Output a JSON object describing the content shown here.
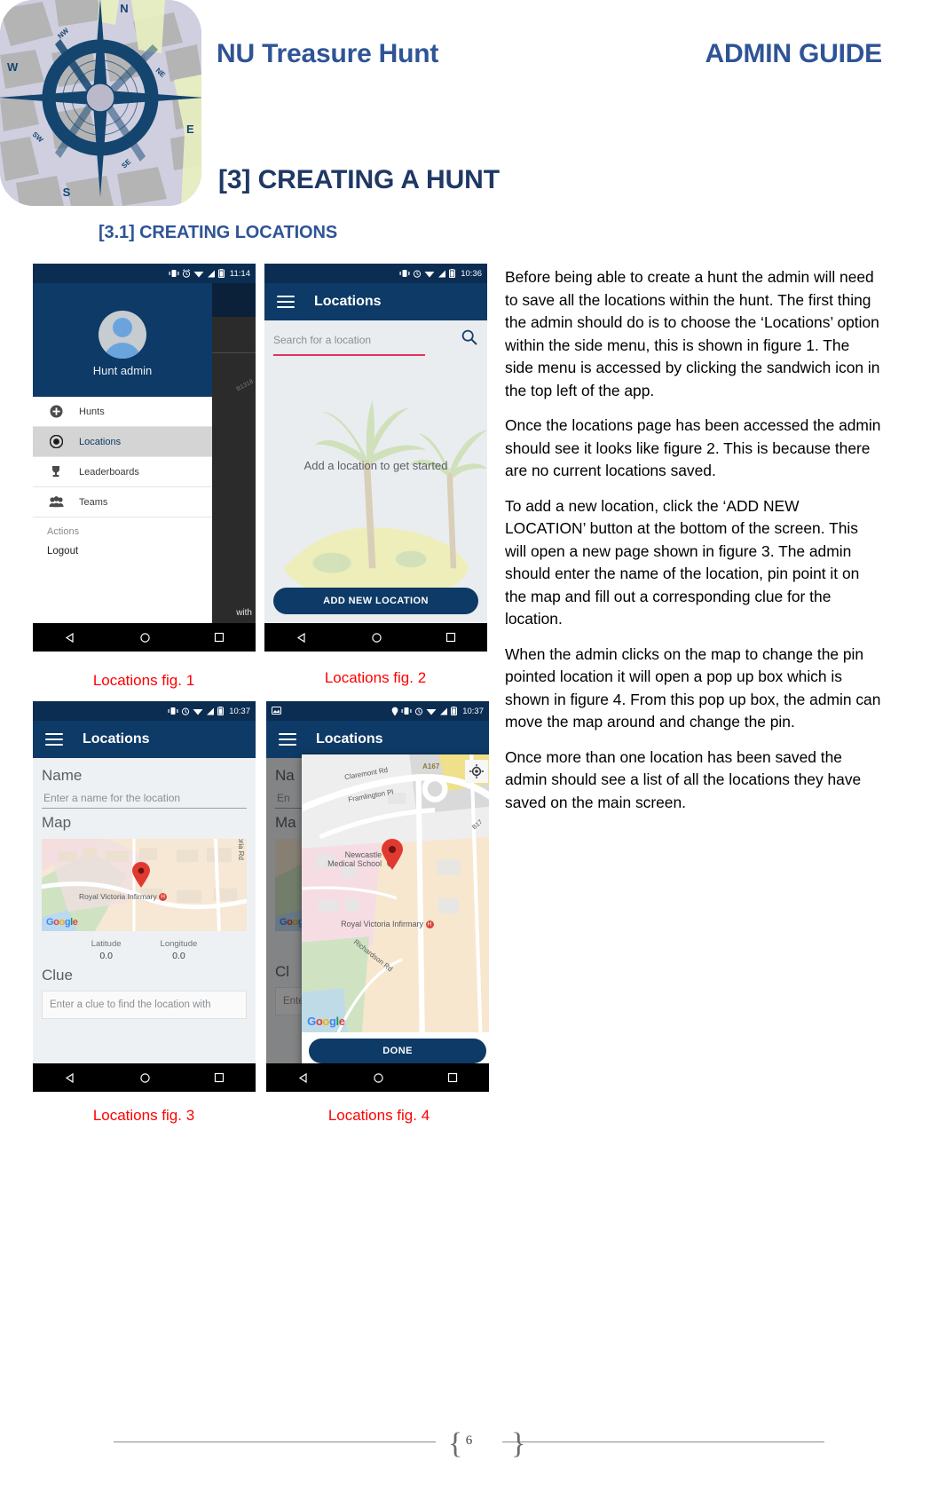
{
  "header": {
    "logo_alt": "compass-rose-map-logo",
    "title": "NU Treasure Hunt",
    "subtitle": "ADMIN GUIDE",
    "brand_color": "#2f5496"
  },
  "headings": {
    "h1": "[3] CREATING A HUNT",
    "h2": "[3.1] CREATING LOCATIONS"
  },
  "body": {
    "paragraphs": [
      "Before being able to create a hunt the admin will need to save all the locations within the hunt. The first thing the admin should do is to choose the ‘Locations’ option within the side menu, this is shown in figure 1. The side menu is accessed by clicking the sandwich icon in the top left of the app.",
      "Once the locations page has been accessed the admin should see it looks like figure 2. This is because there are no current locations saved.",
      "To add a new location, click the ‘ADD NEW LOCATION’ button at the bottom of the screen. This will open a new page shown in figure 3. The admin should enter the name of the location, pin point it on the map and fill out a corresponding clue for the location.",
      "When the admin clicks on the map to change the pin pointed location it will open a pop up box which is shown in figure 4. From this pop up box, the admin can move the map around and change the pin.",
      "Once more than one location has been saved the admin should see a list of all the locations they have saved on the main screen."
    ]
  },
  "figures": {
    "caption_color": "#ff0000",
    "fig1": {
      "caption": "Locations fig. 1",
      "status_time": "11:14",
      "drawer": {
        "user_name": "Hunt admin",
        "items": [
          {
            "label": "Hunts",
            "icon": "plus-circle-icon",
            "active": false
          },
          {
            "label": "Locations",
            "icon": "target-icon",
            "active": true
          },
          {
            "label": "Leaderboards",
            "icon": "trophy-icon",
            "active": false
          },
          {
            "label": "Teams",
            "icon": "people-icon",
            "active": false
          }
        ],
        "section_label": "Actions",
        "logout_label": "Logout"
      },
      "behind_text": "with"
    },
    "fig2": {
      "caption": "Locations fig. 2",
      "status_time": "10:36",
      "appbar_title": "Locations",
      "search_placeholder": "Search for a location",
      "empty_message": "Add a location to get started",
      "add_button": "ADD NEW LOCATION"
    },
    "fig3": {
      "caption": "Locations fig. 3",
      "status_time": "10:37",
      "appbar_title": "Locations",
      "name_label": "Name",
      "name_placeholder": "Enter a name for the location",
      "map_label": "Map",
      "map_place_label": "Royal Victoria Infirmary",
      "map_road_label": "Queen Victoria Rd",
      "latitude_label": "Latitude",
      "latitude_value": "0.0",
      "longitude_label": "Longitude",
      "longitude_value": "0.0",
      "clue_label": "Clue",
      "clue_placeholder": "Enter a clue to find the location with",
      "google_logo": "Google"
    },
    "fig4": {
      "caption": "Locations fig. 4",
      "status_time": "10:37",
      "appbar_title": "Locations",
      "name_label_partial": "Na",
      "name_placeholder_partial": "En",
      "map_label_partial": "Ma",
      "clue_label_partial": "Cl",
      "clue_placeholder": "Enter a clue to find the location with",
      "dialog": {
        "done_button": "DONE",
        "google_logo": "Google",
        "gps_icon": "my-location-icon",
        "map_labels": [
          "Claremont Rd",
          "A167",
          "Framlington Pl",
          "Newcastle",
          "Medical School",
          "Royal Victoria Infirmary",
          "Richardson Rd",
          "B17"
        ]
      }
    }
  },
  "footer": {
    "page_number": "6"
  }
}
